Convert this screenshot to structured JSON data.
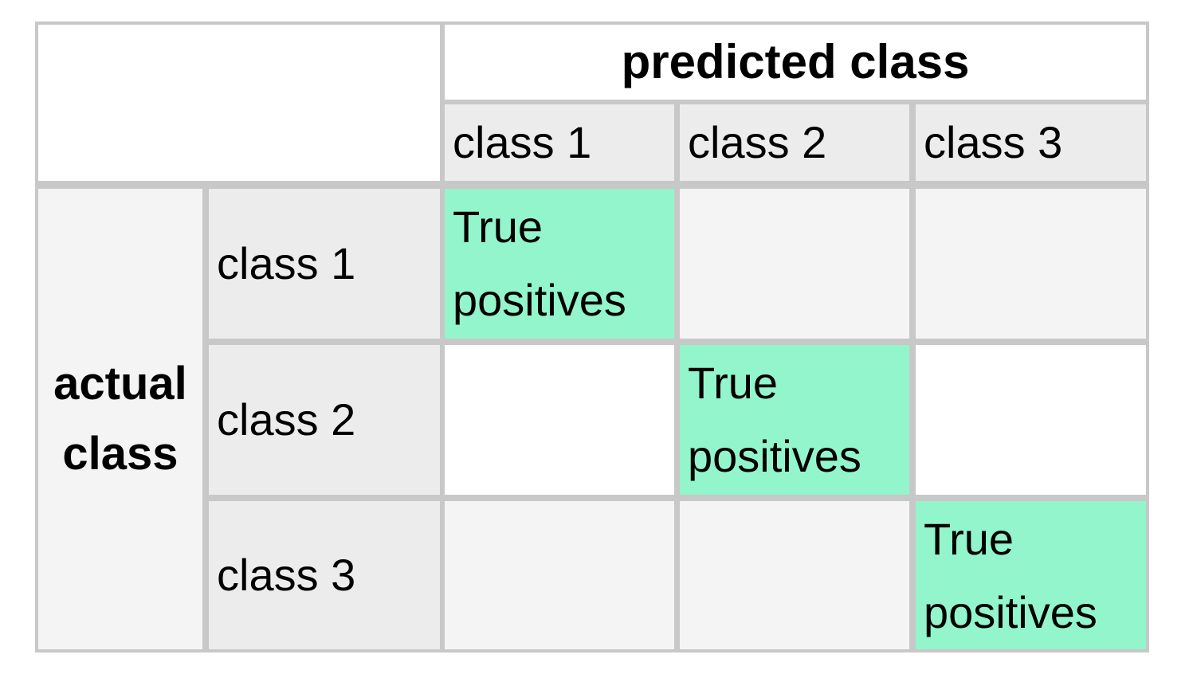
{
  "table": {
    "predicted_header": "predicted class",
    "actual_header": "actual class",
    "columns": [
      "class 1",
      "class 2",
      "class 3"
    ],
    "rows": [
      {
        "label": "class 1",
        "cells": [
          "True positives",
          "",
          ""
        ]
      },
      {
        "label": "class 2",
        "cells": [
          "",
          "True positives",
          ""
        ]
      },
      {
        "label": "class 3",
        "cells": [
          "",
          "",
          "True positives"
        ]
      }
    ],
    "true_positive_color": "#93f5cb",
    "header_color": "#ececec",
    "border_color": "#c8c8c8"
  }
}
